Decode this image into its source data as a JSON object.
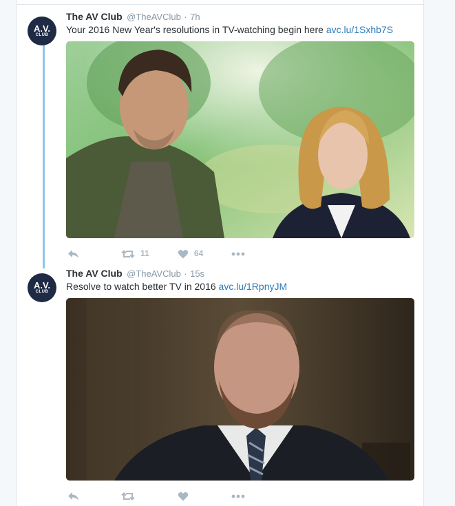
{
  "colors": {
    "page_background": "#f5f8fa",
    "card_background": "#ffffff",
    "link": "#2b7bb9",
    "muted": "#8899a6",
    "icon": "#aab8c2",
    "thread_line": "#8fc4e9",
    "avatar_background": "#1f2a44"
  },
  "tweets": [
    {
      "author_name": "The AV Club",
      "author_handle": "@TheAVClub",
      "separator": "·",
      "time": "7h",
      "text": "Your 2016 New Year's resolutions in TV-watching begin here ",
      "link": "avc.lu/1Sxhb7S",
      "avatar": {
        "main": "A.V.",
        "sub": "CLUB"
      },
      "media": "photo",
      "actions": {
        "reply_icon": "reply-icon",
        "retweet_icon": "retweet-icon",
        "retweet_count": "11",
        "like_icon": "heart-icon",
        "like_count": "64",
        "more_icon": "more-icon"
      }
    },
    {
      "author_name": "The AV Club",
      "author_handle": "@TheAVClub",
      "separator": "·",
      "time": "15s",
      "text": "Resolve to watch better TV in 2016 ",
      "link": "avc.lu/1RpnyJM",
      "avatar": {
        "main": "A.V.",
        "sub": "CLUB"
      },
      "media": "photo",
      "actions": {
        "reply_icon": "reply-icon",
        "retweet_icon": "retweet-icon",
        "retweet_count": "",
        "like_icon": "heart-icon",
        "like_count": "",
        "more_icon": "more-icon"
      }
    }
  ]
}
